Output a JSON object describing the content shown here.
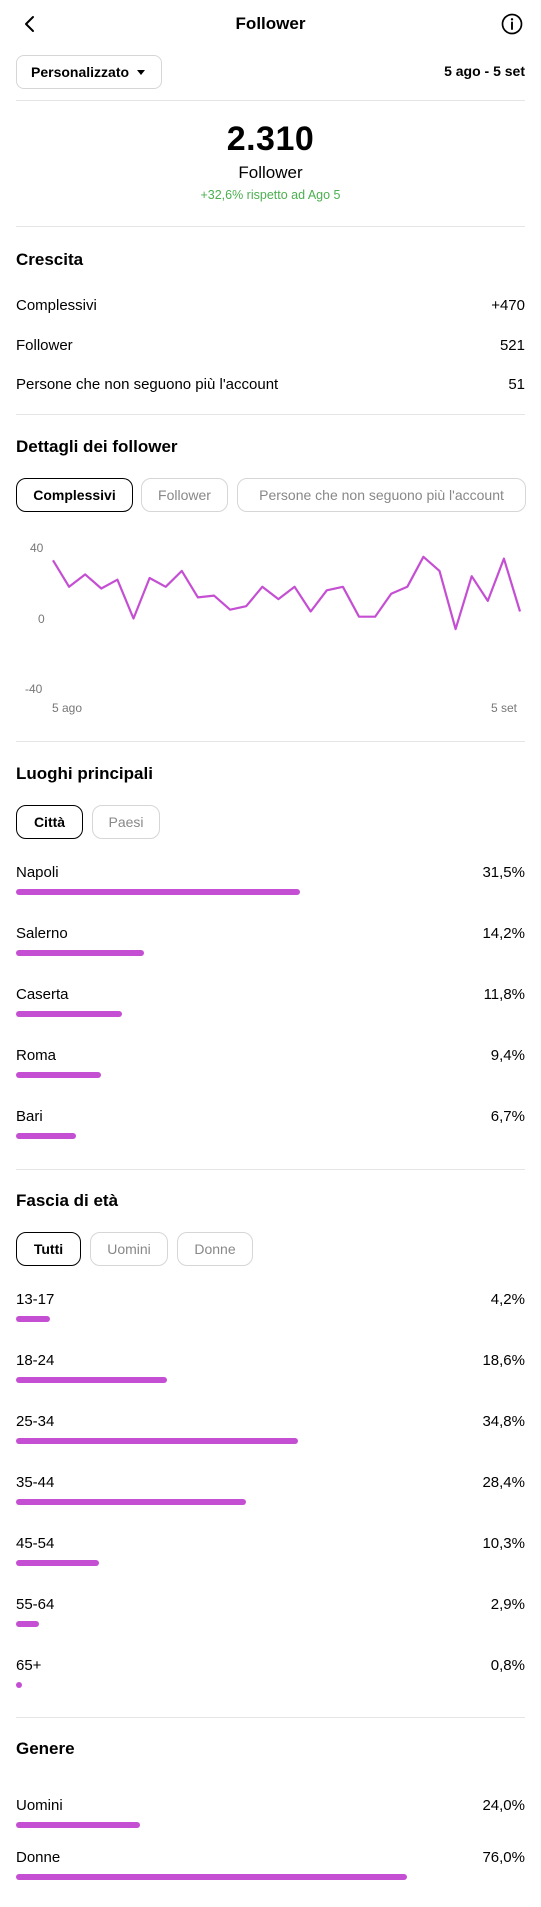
{
  "header": {
    "title": "Follower",
    "back_icon": "back-arrow-icon",
    "info_icon": "info-icon"
  },
  "filter": {
    "period": "Personalizzato",
    "date_range": "5 ago - 5 set"
  },
  "summary": {
    "total": "2.310",
    "label": "Follower",
    "change": "+32,6% rispetto ad Ago 5",
    "change_color": "#4caf50"
  },
  "growth": {
    "title": "Crescita",
    "rows": [
      {
        "label": "Complessivi",
        "value": "+470"
      },
      {
        "label": "Follower",
        "value": "521"
      },
      {
        "label": "Persone che non seguono più l'account",
        "value": "51"
      }
    ]
  },
  "details": {
    "title": "Dettagli dei follower",
    "tabs": [
      "Complessivi",
      "Follower",
      "Persone che non seguono più l'account"
    ]
  },
  "chart_data": {
    "type": "line",
    "x_start_label": "5 ago",
    "x_end_label": "5 set",
    "y_ticks": [
      "40",
      "0",
      "-40"
    ],
    "ylim": [
      -40,
      40
    ],
    "color": "#c54fd3",
    "values": [
      33,
      18,
      25,
      17,
      22,
      0,
      23,
      18,
      27,
      12,
      13,
      5,
      7,
      18,
      11,
      18,
      4,
      16,
      18,
      1,
      1,
      14,
      18,
      35,
      27,
      -6,
      24,
      10,
      34,
      4
    ]
  },
  "locations": {
    "title": "Luoghi principali",
    "tabs": [
      "Città",
      "Paesi"
    ],
    "items": [
      {
        "label": "Napoli",
        "value": "31,5%",
        "pct": 31.5
      },
      {
        "label": "Salerno",
        "value": "14,2%",
        "pct": 14.2
      },
      {
        "label": "Caserta",
        "value": "11,8%",
        "pct": 11.8
      },
      {
        "label": "Roma",
        "value": "9,4%",
        "pct": 9.4
      },
      {
        "label": "Bari",
        "value": "6,7%",
        "pct": 6.7
      }
    ]
  },
  "age": {
    "title": "Fascia di età",
    "tabs": [
      "Tutti",
      "Uomini",
      "Donne"
    ],
    "items": [
      {
        "label": "13-17",
        "value": "4,2%",
        "pct": 4.2
      },
      {
        "label": "18-24",
        "value": "18,6%",
        "pct": 18.6
      },
      {
        "label": "25-34",
        "value": "34,8%",
        "pct": 34.8
      },
      {
        "label": "35-44",
        "value": "28,4%",
        "pct": 28.4
      },
      {
        "label": "45-54",
        "value": "10,3%",
        "pct": 10.3
      },
      {
        "label": "55-64",
        "value": "2,9%",
        "pct": 2.9
      },
      {
        "label": "65+",
        "value": "0,8%",
        "pct": 0.8
      }
    ]
  },
  "gender": {
    "title": "Genere",
    "items": [
      {
        "label": "Uomini",
        "value": "24,0%",
        "pct": 24.0
      },
      {
        "label": "Donne",
        "value": "76,0%",
        "pct": 76.0
      }
    ]
  }
}
